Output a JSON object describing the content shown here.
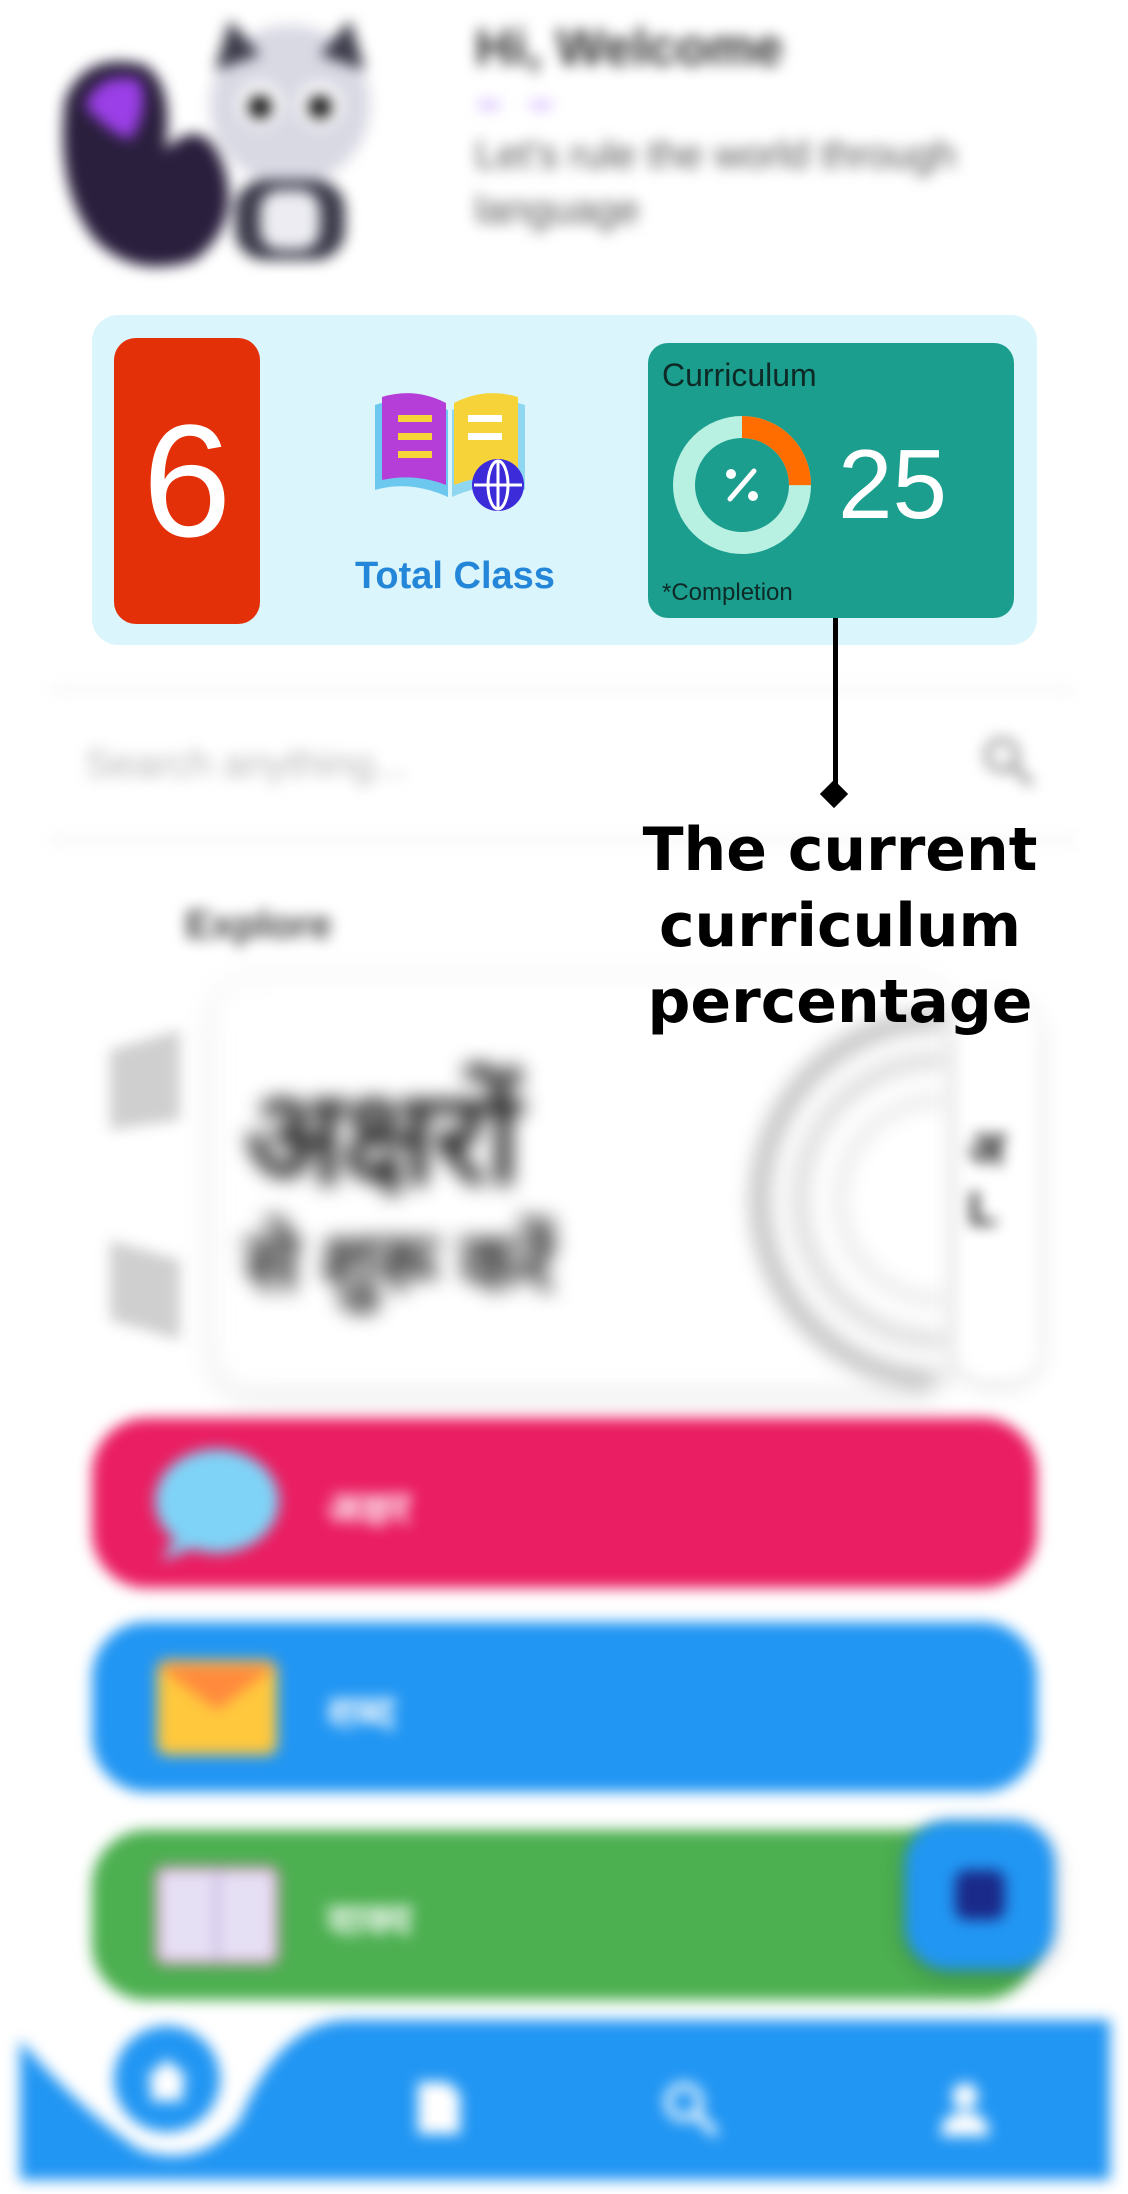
{
  "header": {
    "greeting": "Hi, Welcome",
    "tagline": "Let's rule the world through language"
  },
  "stats": {
    "class_count": "6",
    "total_class_label": "Total Class",
    "curriculum": {
      "title": "Curriculum",
      "value": "25",
      "note": "*Completion",
      "progress_percent": 25,
      "color_ring": "#ff6d00",
      "color_track": "#b8f0e2"
    }
  },
  "search": {
    "placeholder": "Search anything..."
  },
  "explore": {
    "title": "Explore",
    "card_title": "अक्षरों",
    "card_subtitle": "से शुरू करें"
  },
  "categories": [
    {
      "label": "अक्षर",
      "icon": "chat-bubble-icon",
      "color": "#ea1e62"
    },
    {
      "label": "शब्द",
      "icon": "envelope-icon",
      "color": "#2196f3"
    },
    {
      "label": "वाक्य",
      "icon": "open-book-icon",
      "color": "#4caf50"
    }
  ],
  "bottom_nav": {
    "items": [
      "home-icon",
      "document-icon",
      "search-icon",
      "profile-icon"
    ],
    "color": "#2196f3"
  },
  "annotation": {
    "text": "The current curriculum percentage"
  }
}
